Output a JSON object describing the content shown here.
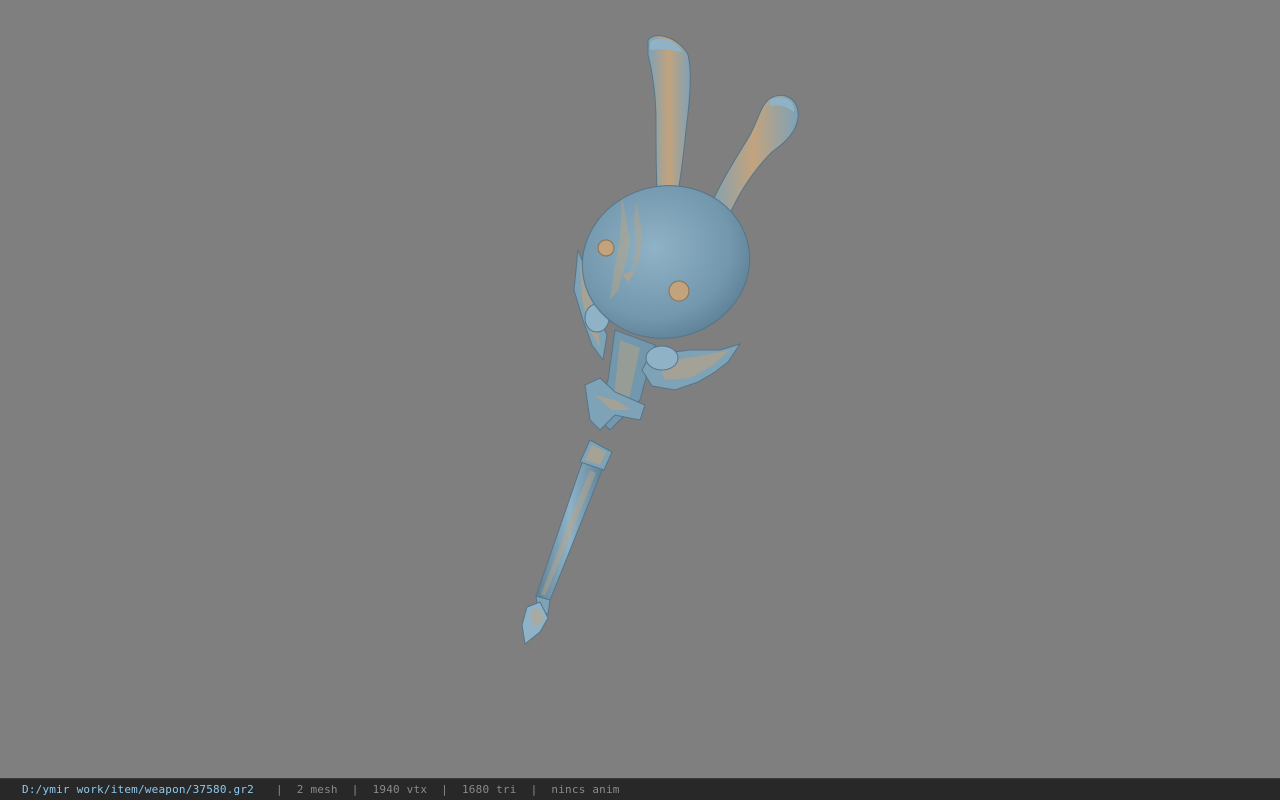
{
  "viewport": {
    "background": "#7f7f7f",
    "model": {
      "icon": "bunny-staff-model",
      "colors": {
        "body": "#7fa3b8",
        "body_shadow": "#5f8197",
        "highlight": "#c2a37d",
        "tip": "#a9c6d6"
      }
    }
  },
  "status_bar": {
    "file_path": "D:/ymir work/item/weapon/37580.gr2",
    "separator": "|",
    "mesh_count": "2 mesh",
    "vertex_count": "1940 vtx",
    "triangle_count": "1680 tri",
    "anim_status": "nincs anim",
    "colors": {
      "background": "#282828",
      "path_text": "#8ec8ee",
      "stat_text": "#8a8a8a"
    }
  }
}
